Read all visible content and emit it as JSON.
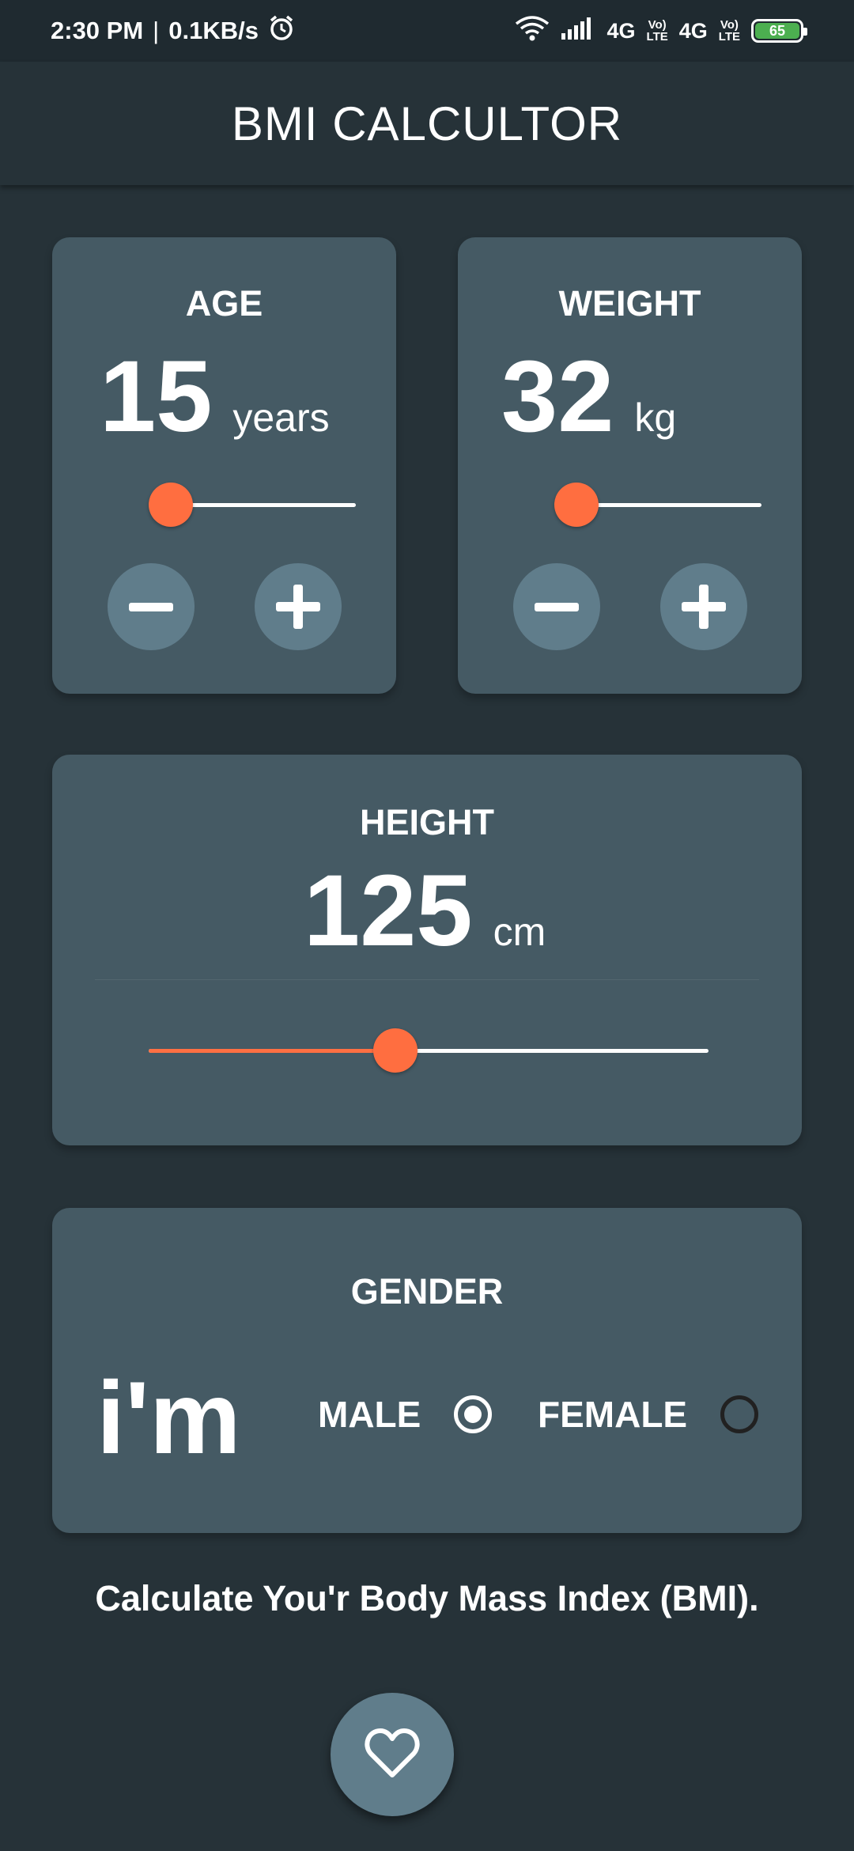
{
  "status_bar": {
    "time": "2:30 PM",
    "net_speed": "0.1KB/s",
    "network_1": "4G",
    "network_2": "4G",
    "lte_top": "Vo)",
    "lte_bottom": "LTE",
    "battery": "65"
  },
  "app_bar": {
    "title": "BMI CALCULTOR"
  },
  "age_card": {
    "label": "AGE",
    "value": "15",
    "unit": "years",
    "slider_fraction": 0.05,
    "minus_icon": "minus-icon",
    "plus_icon": "plus-icon"
  },
  "weight_card": {
    "label": "WEIGHT",
    "value": "32",
    "unit": "kg",
    "slider_fraction": 0.05,
    "minus_icon": "minus-icon",
    "plus_icon": "plus-icon"
  },
  "height_card": {
    "label": "HEIGHT",
    "value": "125",
    "unit": "cm",
    "slider_fraction": 0.44,
    "accent_color": "#ff7043"
  },
  "gender_card": {
    "label": "GENDER",
    "prefix": "i'm",
    "options": [
      {
        "label": "MALE",
        "selected": true
      },
      {
        "label": "FEMALE",
        "selected": false
      }
    ]
  },
  "tagline": "Calculate You'r Body Mass Index (BMI).",
  "fab": {
    "icon": "heart-icon"
  },
  "colors": {
    "background": "#263238",
    "card": "#455a64",
    "button": "#607d8b",
    "accent": "#ff6e40"
  }
}
